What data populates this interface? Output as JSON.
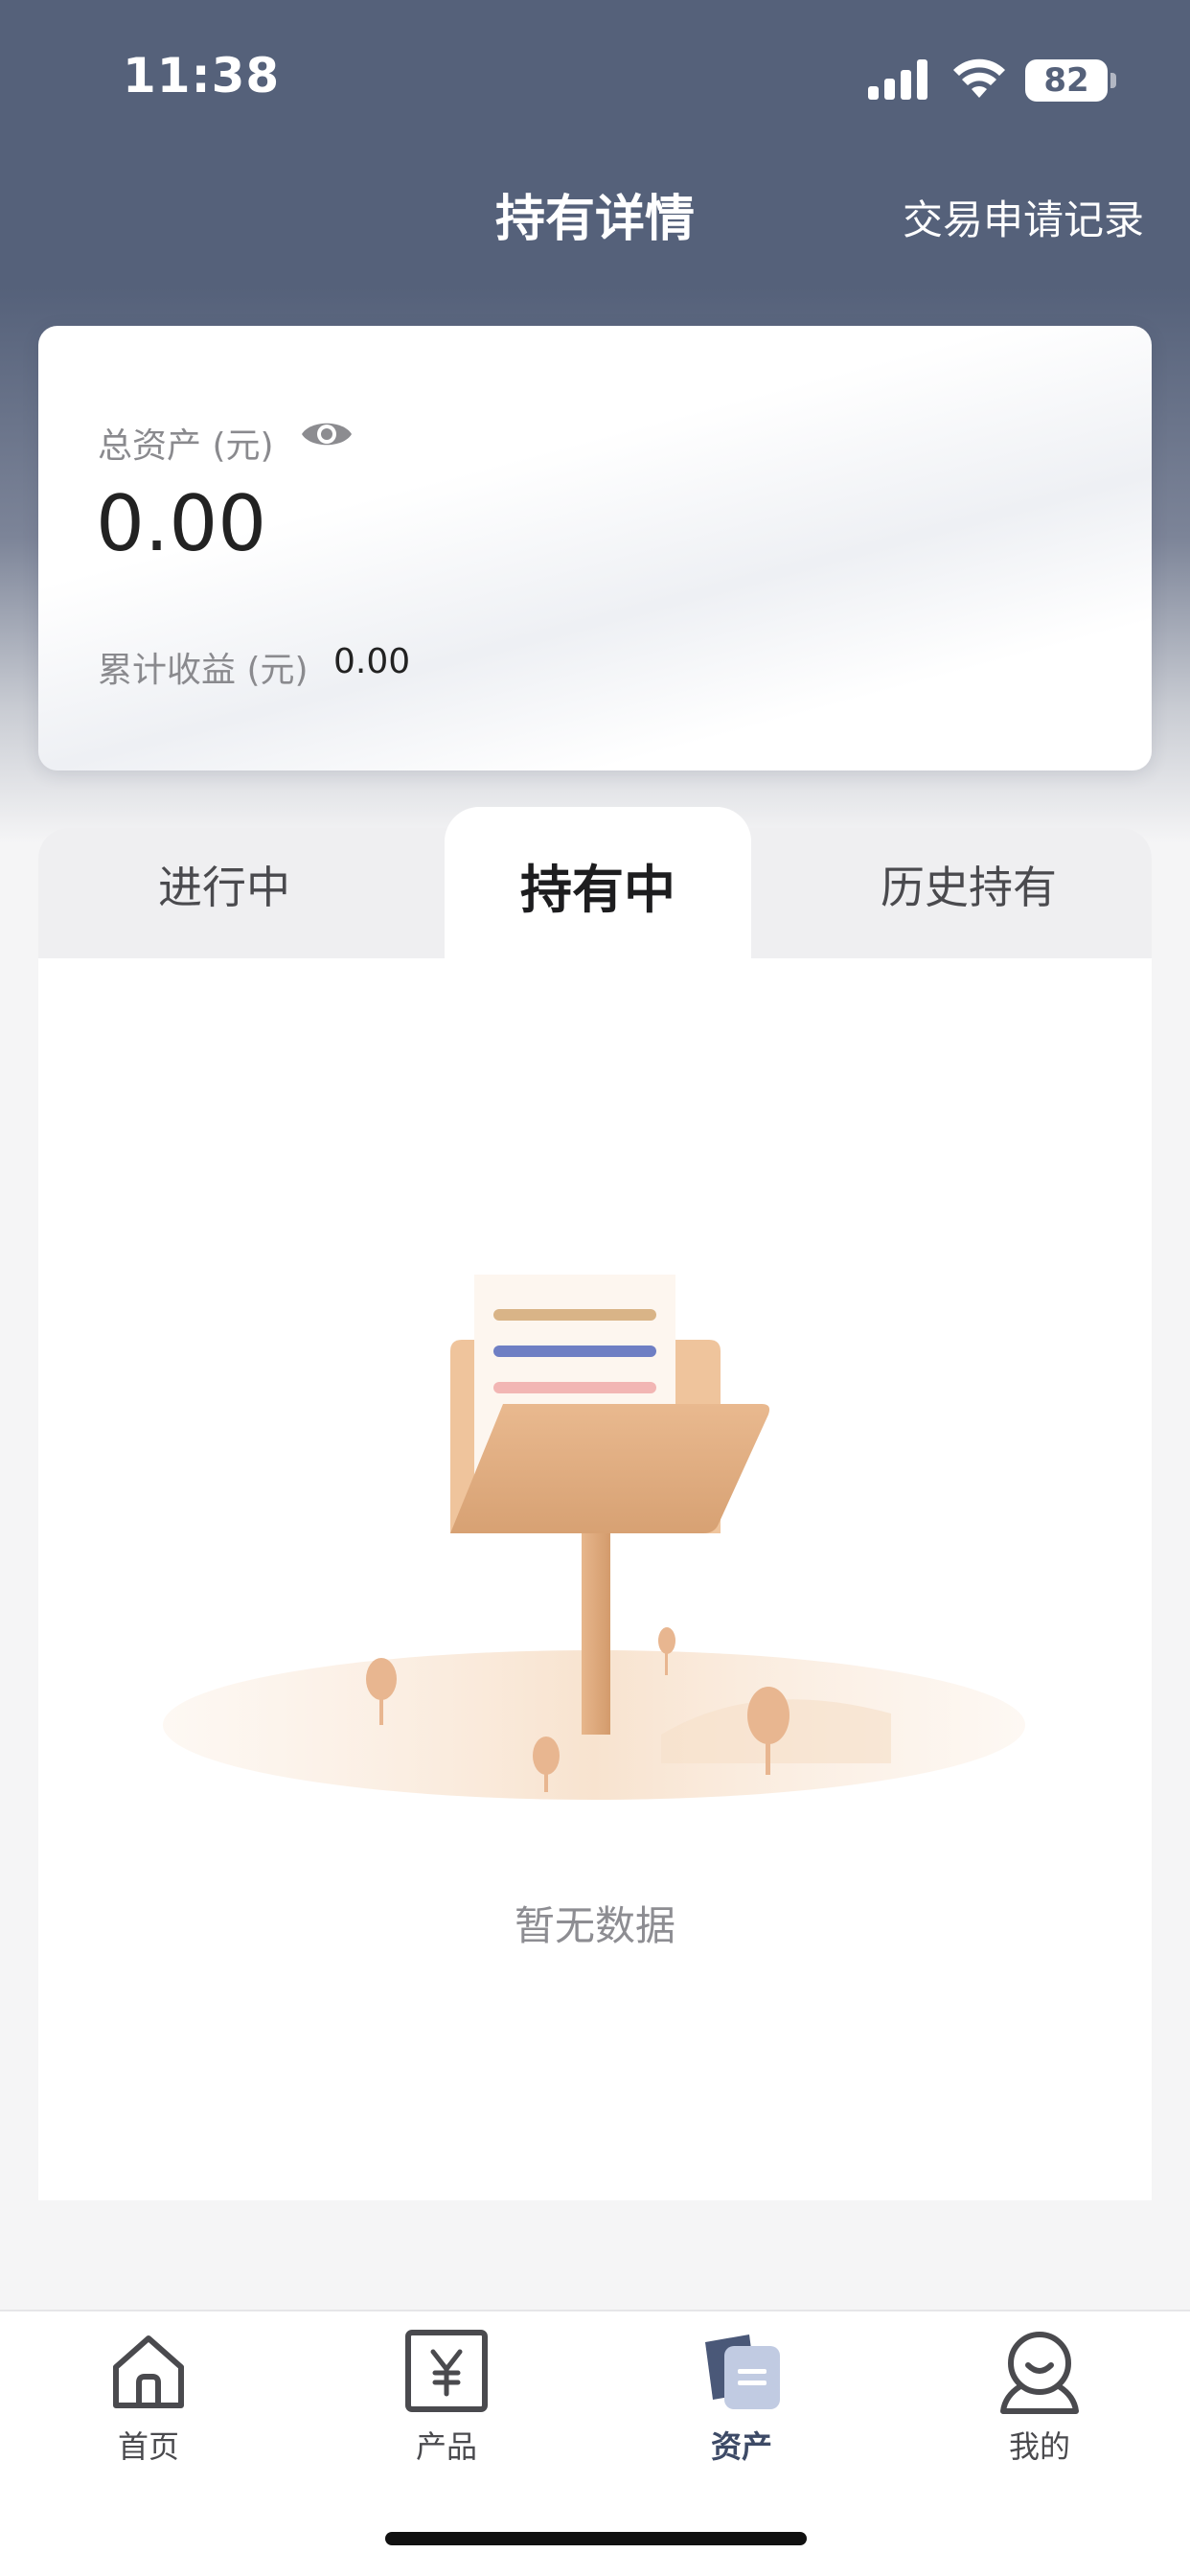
{
  "status_bar": {
    "time": "11:38",
    "battery": "82",
    "icons": [
      "signal-icon",
      "wifi-icon",
      "battery-icon"
    ]
  },
  "nav": {
    "title": "持有详情",
    "action": "交易申请记录"
  },
  "assets": {
    "total_label": "总资产 (元)",
    "total_value": "0.00",
    "earnings_label": "累计收益 (元)",
    "earnings_value": "0.00",
    "visibility_icon": "eye-icon"
  },
  "tabs": [
    {
      "label": "进行中",
      "active": false
    },
    {
      "label": "持有中",
      "active": true
    },
    {
      "label": "历史持有",
      "active": false
    }
  ],
  "empty_state": {
    "text": "暂无数据",
    "icon": "empty-folder-illustration"
  },
  "tabbar": [
    {
      "label": "首页",
      "icon": "home-icon",
      "active": false
    },
    {
      "label": "产品",
      "icon": "yuan-icon",
      "active": false
    },
    {
      "label": "资产",
      "icon": "assets-icon",
      "active": true
    },
    {
      "label": "我的",
      "icon": "profile-icon",
      "active": false
    }
  ],
  "colors": {
    "header": "#55617a",
    "accent": "#3d4a66",
    "illustration": "#e4b48a"
  }
}
